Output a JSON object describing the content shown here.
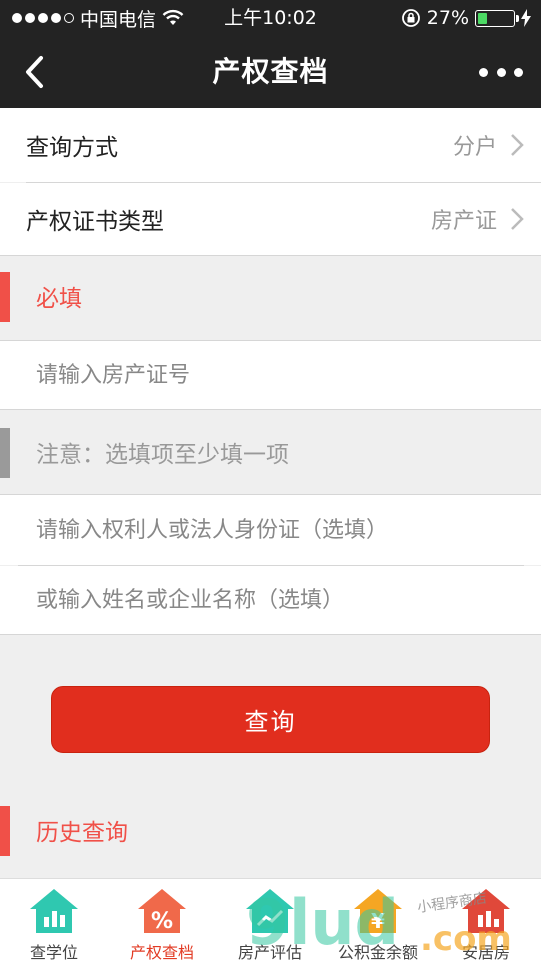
{
  "status_bar": {
    "carrier": "中国电信",
    "time": "上午10:02",
    "battery_percent": "27%",
    "battery_level": 0.27
  },
  "nav": {
    "title": "产权查档"
  },
  "form": {
    "query_method": {
      "label": "查询方式",
      "value": "分户"
    },
    "cert_type": {
      "label": "产权证书类型",
      "value": "房产证"
    },
    "required_section": "必填",
    "cert_number_placeholder": "请输入房产证号",
    "notice": "注意：选填项至少填一项",
    "id_placeholder": "请输入权利人或法人身份证（选填）",
    "name_placeholder": "或输入姓名或企业名称（选填）",
    "submit_label": "查询",
    "history_section": "历史查询"
  },
  "tabbar": {
    "items": [
      {
        "label": "查学位",
        "color": "#2fc8b0"
      },
      {
        "label": "产权查档",
        "color": "#f0694a"
      },
      {
        "label": "房产评估",
        "color": "#2fc8b0"
      },
      {
        "label": "公积金余额",
        "color": "#f5a623"
      },
      {
        "label": "安居房",
        "color": "#e0483a"
      }
    ]
  },
  "watermark": {
    "text": "9lud.com",
    "subtext": "小程序商店"
  },
  "colors": {
    "accent_red": "#e12e1e",
    "section_red": "#f05048",
    "notice_gray": "#999999"
  }
}
